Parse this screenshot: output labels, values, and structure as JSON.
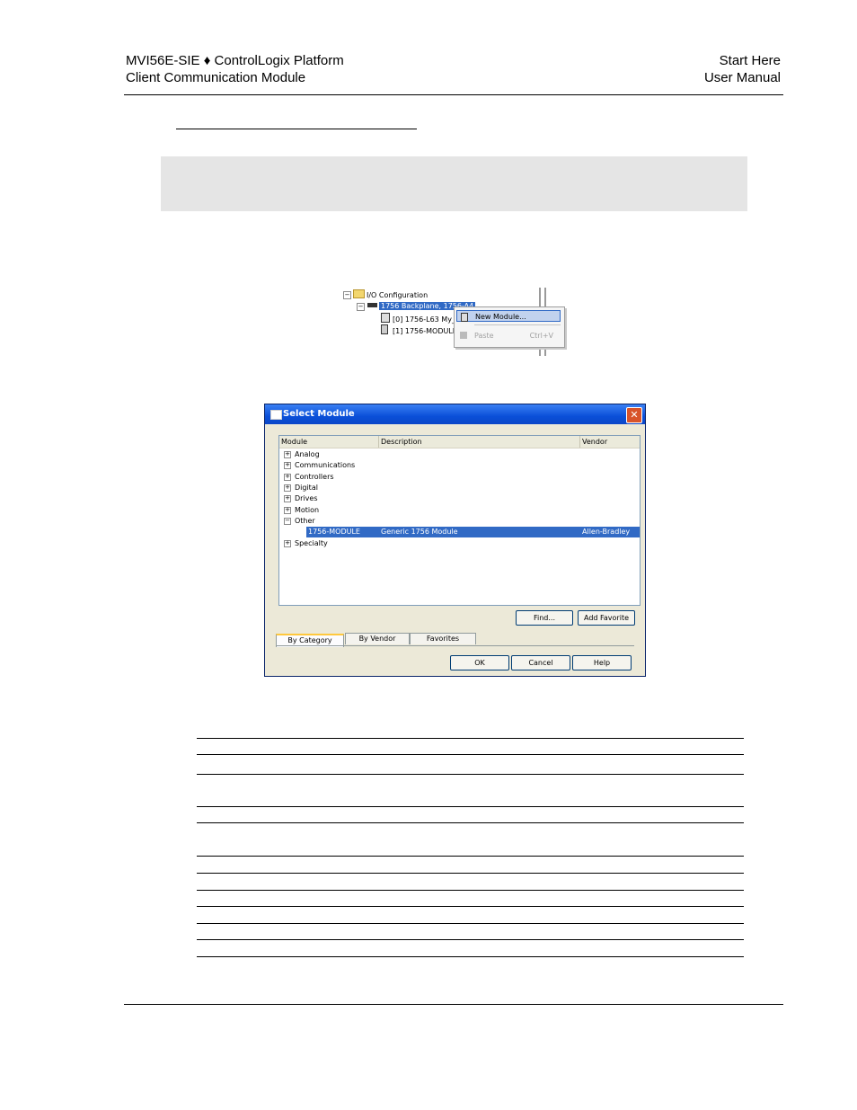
{
  "header": {
    "left_line1": "MVI56E-SIE ♦ ControlLogix Platform",
    "left_line2": "Client Communication Module",
    "right_line1": "Start Here",
    "right_line2": "User Manual"
  },
  "tree_screenshot": {
    "root": "I/O Configuration",
    "backplane": "1756 Backplane, 1756-A4",
    "slot0": "[0] 1756-L63 My_",
    "slot1": "[1] 1756-MODULE",
    "menu_new_module": "New Module...",
    "menu_paste": "Paste",
    "menu_paste_shortcut": "Ctrl+V"
  },
  "dialog": {
    "title": "Select Module",
    "close_glyph": "✕",
    "columns": [
      "Module",
      "Description",
      "Vendor"
    ],
    "categories": [
      "Analog",
      "Communications",
      "Controllers",
      "Digital",
      "Drives",
      "Motion",
      "Other",
      "Specialty"
    ],
    "selected_row": {
      "module": "1756-MODULE",
      "description": "Generic 1756 Module",
      "vendor": "Allen-Bradley"
    },
    "find_button": "Find...",
    "add_favorite_button": "Add Favorite",
    "tabs": [
      "By Category",
      "By Vendor",
      "Favorites"
    ],
    "ok_button": "OK",
    "cancel_button": "Cancel",
    "help_button": "Help"
  }
}
